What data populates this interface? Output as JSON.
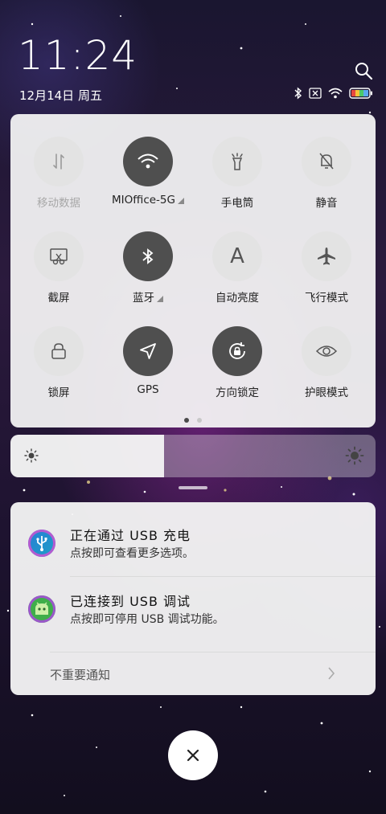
{
  "status": {
    "time": "11:24",
    "date": "12月14日 周五",
    "icons": [
      "bluetooth-icon",
      "no-sim-icon",
      "wifi-icon",
      "battery-icon"
    ]
  },
  "quick_settings": {
    "tiles": [
      {
        "label": "移动数据",
        "icon": "mobile-data-icon",
        "active": false,
        "disabled": true
      },
      {
        "label": "MIOffice-5G",
        "icon": "wifi-icon",
        "active": true,
        "expandable": true
      },
      {
        "label": "手电筒",
        "icon": "flashlight-icon",
        "active": false
      },
      {
        "label": "静音",
        "icon": "mute-bell-icon",
        "active": false
      },
      {
        "label": "截屏",
        "icon": "screenshot-icon",
        "active": false
      },
      {
        "label": "蓝牙",
        "icon": "bluetooth-icon",
        "active": true,
        "expandable": true
      },
      {
        "label": "自动亮度",
        "icon": "auto-brightness-icon",
        "active": false
      },
      {
        "label": "飞行模式",
        "icon": "airplane-icon",
        "active": false
      },
      {
        "label": "锁屏",
        "icon": "lock-icon",
        "active": false
      },
      {
        "label": "GPS",
        "icon": "location-arrow-icon",
        "active": true
      },
      {
        "label": "方向锁定",
        "icon": "rotation-lock-icon",
        "active": true
      },
      {
        "label": "护眼模式",
        "icon": "eye-icon",
        "active": false
      }
    ],
    "page_count": 2,
    "current_page": 1
  },
  "brightness": {
    "level": 0.42
  },
  "notifications": [
    {
      "title": "正在通过 USB 充电",
      "subtitle": "点按即可查看更多选项。",
      "icon": "usb-icon",
      "icon_color": "#1e88c8"
    },
    {
      "title": "已连接到 USB 调试",
      "subtitle": "点按即可停用 USB 调试功能。",
      "icon": "android-debug-icon",
      "icon_color": "#3fae4a"
    }
  ],
  "unimportant_label": "不重要通知",
  "colors": {
    "tile_active": "#4f4f4f",
    "tile_inactive": "#e3e3e3",
    "panel": "#f6f6f6"
  }
}
